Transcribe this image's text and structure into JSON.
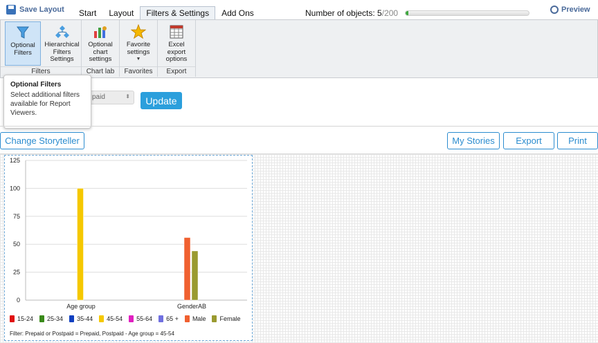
{
  "toolbar": {
    "save_layout": "Save Layout",
    "preview": "Preview"
  },
  "tabs": [
    {
      "label": "Start"
    },
    {
      "label": "Layout"
    },
    {
      "label": "Filters & Settings"
    },
    {
      "label": "Add Ons"
    }
  ],
  "objects": {
    "label": "Number of objects: ",
    "current": "5",
    "total": "/200",
    "progress_fraction": 0.025
  },
  "ribbon": {
    "groups": [
      {
        "label": "Filters",
        "buttons": [
          {
            "label": "Optional Filters",
            "icon": "funnel-icon"
          },
          {
            "label": "Hierarchical Filters Settings",
            "icon": "hierarchy-icon"
          }
        ]
      },
      {
        "label": "Chart lab",
        "buttons": [
          {
            "label": "Optional chart settings",
            "icon": "chart-settings-icon"
          }
        ]
      },
      {
        "label": "Favorites",
        "buttons": [
          {
            "label": "Favorite settings",
            "icon": "star-icon"
          }
        ]
      },
      {
        "label": "Export",
        "buttons": [
          {
            "label": "Excel export options",
            "icon": "excel-icon"
          }
        ]
      }
    ]
  },
  "tooltip": {
    "title": "Optional Filters",
    "body": "Select additional filters available for Report Viewers."
  },
  "filter_select": {
    "value": "paid"
  },
  "update_button": "Update",
  "actions": {
    "change_storyteller": "Change Storyteller",
    "my_stories": "My Stories",
    "export": "Export",
    "print": "Print"
  },
  "colors": {
    "accent": "#2b9fdc",
    "progress": "#3ea83e"
  },
  "chart_data": {
    "type": "bar",
    "categories": [
      "Age group",
      "GenderAB"
    ],
    "series": [
      {
        "name": "15-24",
        "color": "#e01010",
        "values": [
          0,
          0
        ]
      },
      {
        "name": "25-34",
        "color": "#3a8a1a",
        "values": [
          0,
          0
        ]
      },
      {
        "name": "35-44",
        "color": "#1040c0",
        "values": [
          0,
          0
        ]
      },
      {
        "name": "45-54",
        "color": "#f5c800",
        "values": [
          100,
          0
        ]
      },
      {
        "name": "55-64",
        "color": "#e020c0",
        "values": [
          0,
          0
        ]
      },
      {
        "name": "65 +",
        "color": "#7070e0",
        "values": [
          0,
          0
        ]
      },
      {
        "name": "Male",
        "color": "#f06030",
        "values": [
          0,
          56
        ]
      },
      {
        "name": "Female",
        "color": "#9a9a30",
        "values": [
          0,
          44
        ]
      }
    ],
    "yticks": [
      "0",
      "25",
      "50",
      "75",
      "100",
      "125"
    ],
    "ylim": [
      0,
      125
    ],
    "filter_text": "Filter: Prepaid or Postpaid = Prepaid, Postpaid - Age group = 45-54"
  }
}
